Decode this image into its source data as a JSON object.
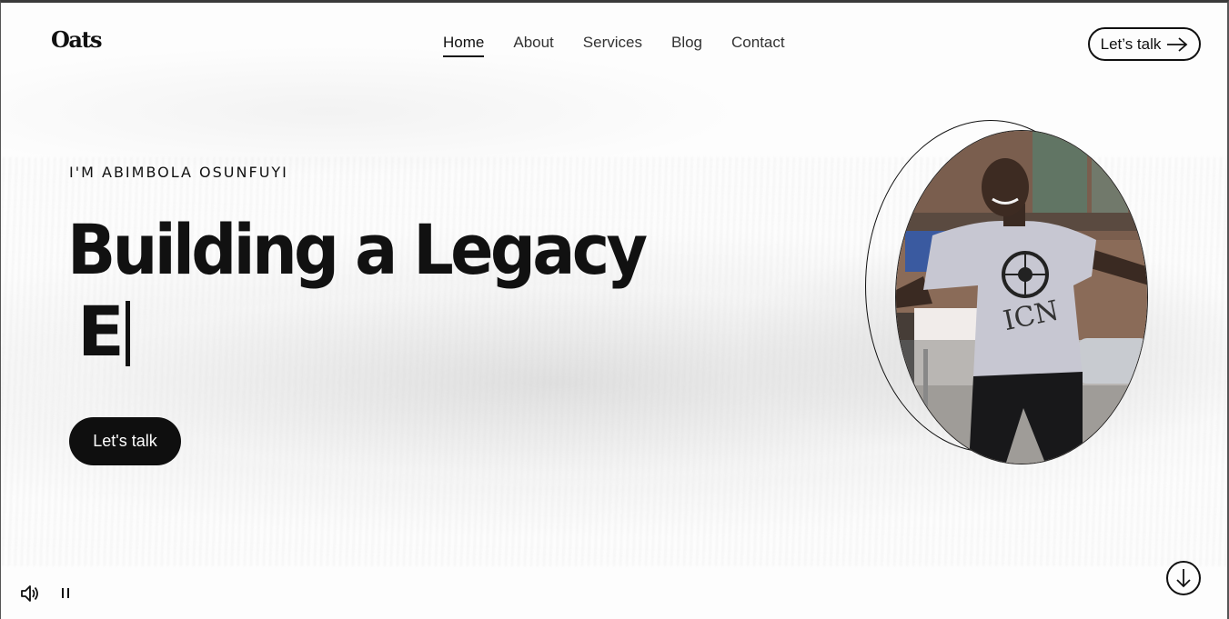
{
  "header": {
    "logo": "Oats",
    "nav": [
      {
        "label": "Home",
        "active": true
      },
      {
        "label": "About",
        "active": false
      },
      {
        "label": "Services",
        "active": false
      },
      {
        "label": "Blog",
        "active": false
      },
      {
        "label": "Contact",
        "active": false
      }
    ],
    "cta_label": "Let’s talk"
  },
  "hero": {
    "eyebrow": "I'M ABIMBOLA OSUNFUYI",
    "headline": "Building a Legacy",
    "typed_text": "E",
    "cta_label": "Let's talk"
  },
  "portrait": {
    "shirt_text": "ICN"
  },
  "controls": {
    "sound_icon": "speaker-icon",
    "pause_icon": "pause-icon",
    "scroll_icon": "arrow-down-icon"
  },
  "colors": {
    "text": "#111111",
    "cta_bg": "#0f0f0f",
    "background": "#fdfdfd"
  }
}
